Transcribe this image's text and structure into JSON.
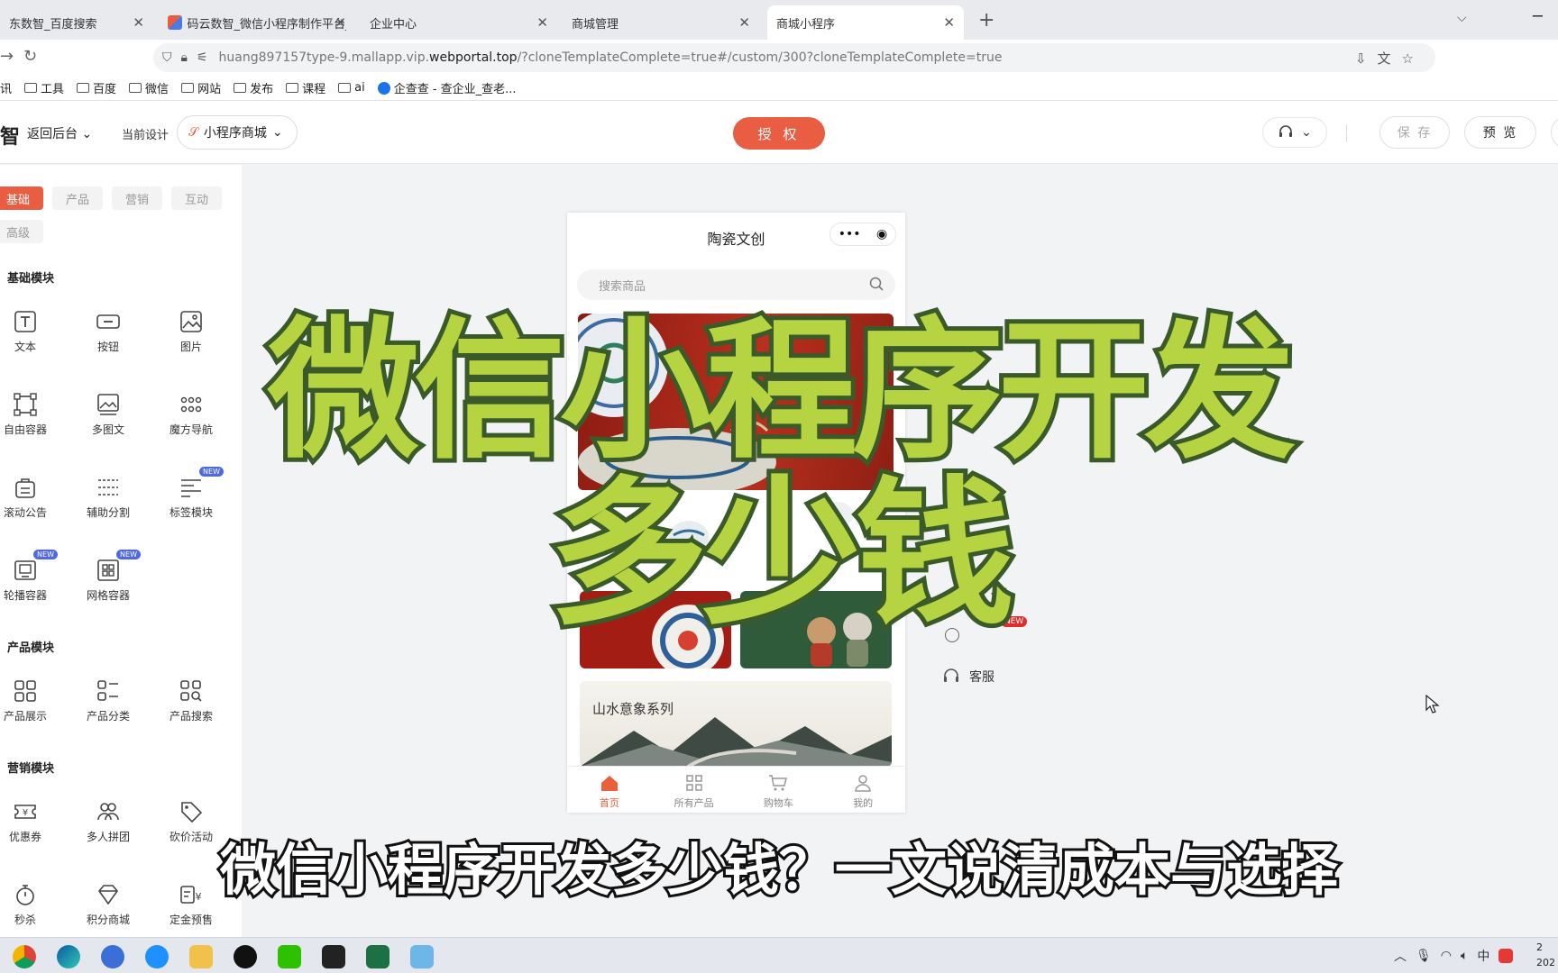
{
  "browser": {
    "tabs": [
      {
        "label": "东数智_百度搜索"
      },
      {
        "label": "码云数智_微信小程序制作平台_"
      },
      {
        "label": "企业中心"
      },
      {
        "label": "商城管理"
      },
      {
        "label": "商城小程序"
      }
    ],
    "url_prefix": "huang897157type-9.mallapp.vip.",
    "url_domain": "webportal.top",
    "url_suffix": "/?cloneTemplateComplete=true#/custom/300?cloneTemplateComplete=true",
    "bookmarks": [
      "讯",
      "工具",
      "百度",
      "微信",
      "网站",
      "发布",
      "课程",
      "ai",
      "企查查 - 查企业_查老..."
    ]
  },
  "header": {
    "brand": "智",
    "back_label": "返回后台",
    "current_design_label": "当前设计",
    "design_select": "小程序商城",
    "auth_button": "授 权",
    "save_button": "保 存",
    "preview_button": "预 览"
  },
  "left_panel": {
    "tabs": [
      "基础",
      "产品",
      "营销",
      "互动",
      "高级"
    ],
    "sections": {
      "basic": "基础模块",
      "product": "产品模块",
      "marketing": "营销模块"
    },
    "basic_items": [
      "文本",
      "按钮",
      "图片",
      "自由容器",
      "多图文",
      "魔方导航",
      "滚动公告",
      "辅助分割",
      "标签模块",
      "轮播容器",
      "网格容器"
    ],
    "product_items": [
      "产品展示",
      "产品分类",
      "产品搜索"
    ],
    "marketing_items": [
      "优惠券",
      "多人拼团",
      "砍价活动",
      "秒杀",
      "积分商城",
      "定金预售"
    ],
    "new_badge": "NEW"
  },
  "phone": {
    "title": "陶瓷文创",
    "search_placeholder": "搜索商品",
    "landscape_title": "山水意象系列",
    "tabbar": [
      "首页",
      "所有产品",
      "购物车",
      "我的"
    ]
  },
  "side_options": {
    "customer_service": "客服"
  },
  "overlay": {
    "title_line1": "微信小程序开发",
    "title_line2": "多少钱",
    "subtitle": "微信小程序开发多少钱？一文说清成本与选择"
  },
  "taskbar": {
    "ime": "中",
    "clock_time": "2",
    "clock_date": "202"
  },
  "colors": {
    "accent": "#e95d42",
    "overlay_fill": "#b6d341",
    "overlay_stroke": "#3a5a2a"
  }
}
